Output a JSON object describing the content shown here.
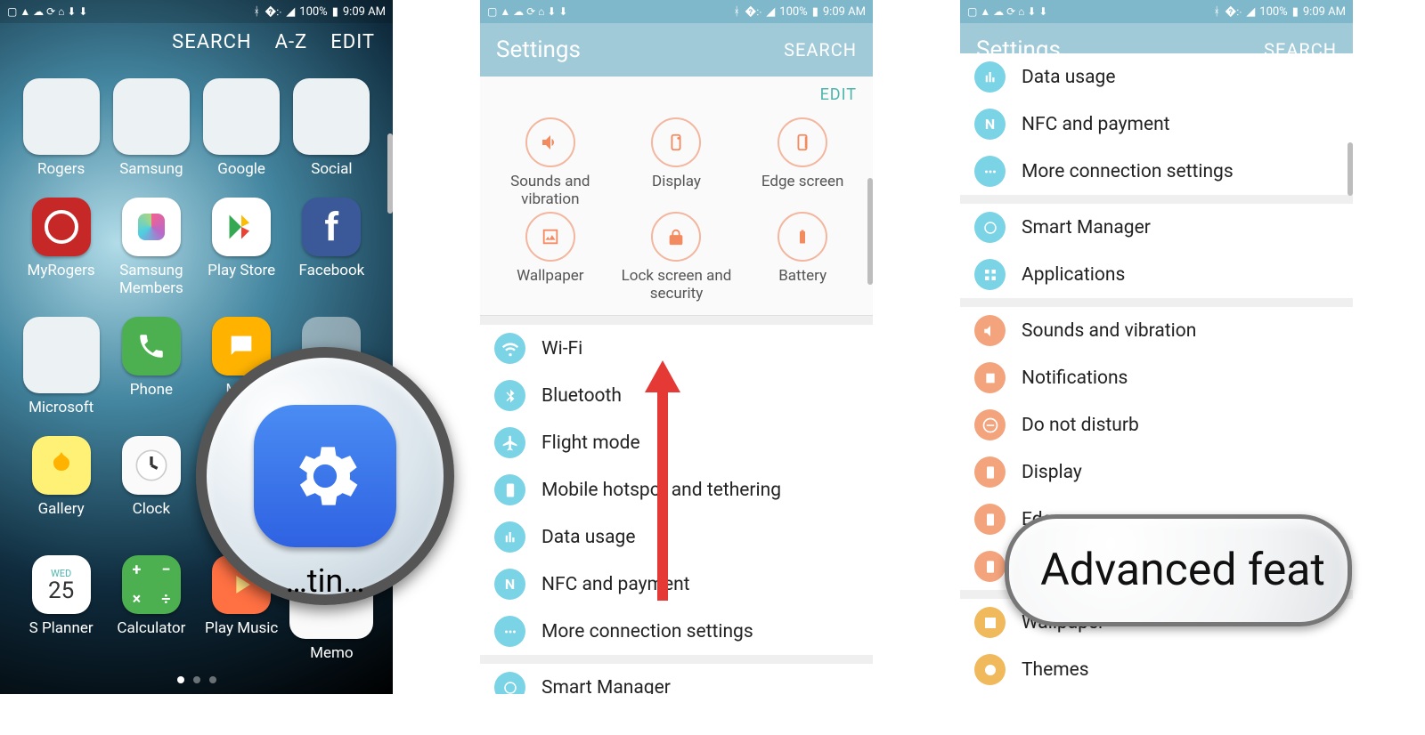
{
  "status": {
    "battery": "100%",
    "time": "9:09 AM"
  },
  "drawer": {
    "search": "SEARCH",
    "az": "A-Z",
    "edit": "EDIT",
    "highlight_partial_label": "…tin…",
    "apps": [
      "Rogers",
      "Samsung",
      "Google",
      "Social",
      "MyRogers",
      "Samsung Members",
      "Play Store",
      "Facebook",
      "Microsoft",
      "Phone",
      "Me…",
      "",
      "Gallery",
      "Clock",
      "",
      "",
      "S Planner",
      "Calculator",
      "Play Music",
      "Memo"
    ]
  },
  "settings": {
    "title": "Settings",
    "search": "SEARCH",
    "edit": "EDIT",
    "quick": [
      "Sounds and vibration",
      "Display",
      "Edge screen",
      "Wallpaper",
      "Lock screen and security",
      "Battery"
    ],
    "list2": [
      "Wi-Fi",
      "Bluetooth",
      "Flight mode",
      "Mobile hotspot and tethering",
      "Data usage",
      "NFC and payment",
      "More connection settings",
      "Smart Manager"
    ]
  },
  "settings3": {
    "title": "Settings",
    "search": "SEARCH",
    "list": [
      "Data usage",
      "NFC and payment",
      "More connection settings",
      "Smart Manager",
      "Applications",
      "Sounds and vibration",
      "Notifications",
      "Do not disturb",
      "Display",
      "Edge screen",
      "",
      "Wallpaper",
      "Themes"
    ],
    "groups": {
      "break_after": [
        2,
        4
      ]
    }
  },
  "callout": "Advanced feat"
}
